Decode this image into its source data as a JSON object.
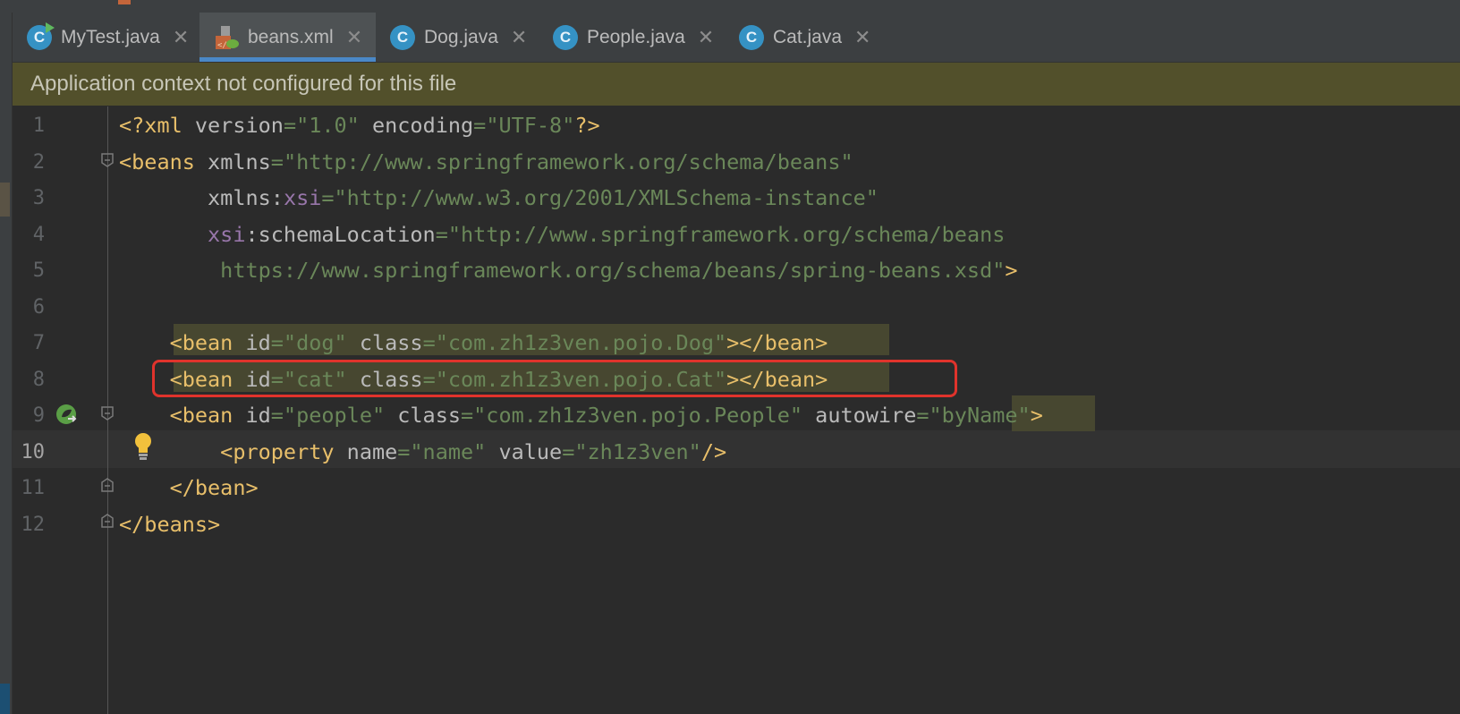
{
  "tabs": [
    {
      "label": "MyTest.java",
      "icon": "java-class-run-icon",
      "active": false
    },
    {
      "label": "beans.xml",
      "icon": "spring-xml-icon",
      "active": true
    },
    {
      "label": "Dog.java",
      "icon": "java-class-icon",
      "active": false
    },
    {
      "label": "People.java",
      "icon": "java-class-icon",
      "active": false
    },
    {
      "label": "Cat.java",
      "icon": "java-class-icon",
      "active": false
    }
  ],
  "tab_close_glyph": "✕",
  "class_icon_letter": "C",
  "banner": {
    "text": "Application context not configured for this file"
  },
  "editor": {
    "line_numbers": [
      "1",
      "2",
      "3",
      "4",
      "5",
      "6",
      "7",
      "8",
      "9",
      "10",
      "11",
      "12"
    ],
    "current_line": "10",
    "lines": [
      [
        {
          "t": "tag",
          "v": "<?xml "
        },
        {
          "t": "attr",
          "v": "version"
        },
        {
          "t": "str",
          "v": "=\"1.0\" "
        },
        {
          "t": "attr",
          "v": "encoding"
        },
        {
          "t": "str",
          "v": "=\"UTF-8\""
        },
        {
          "t": "tag",
          "v": "?>"
        }
      ],
      [
        {
          "t": "tag",
          "v": "<beans "
        },
        {
          "t": "attr",
          "v": "xmlns"
        },
        {
          "t": "str",
          "v": "=\"http://www.springframework.org/schema/beans\""
        }
      ],
      [
        {
          "t": "attr",
          "v": "       xmlns:"
        },
        {
          "t": "ns",
          "v": "xsi"
        },
        {
          "t": "str",
          "v": "=\"http://www.w3.org/2001/XMLSchema-instance\""
        }
      ],
      [
        {
          "t": "ns",
          "v": "       xsi"
        },
        {
          "t": "attr",
          "v": ":schemaLocation"
        },
        {
          "t": "str",
          "v": "=\"http://www.springframework.org/schema/beans"
        }
      ],
      [
        {
          "t": "str",
          "v": "        https://www.springframework.org/schema/beans/spring-beans.xsd\""
        },
        {
          "t": "tag",
          "v": ">"
        }
      ],
      [],
      [
        {
          "t": "tag",
          "v": "    <bean "
        },
        {
          "t": "attr",
          "v": "id"
        },
        {
          "t": "str",
          "v": "=\"dog\" "
        },
        {
          "t": "attr",
          "v": "class"
        },
        {
          "t": "str",
          "v": "=\"com.zh1z3ven.pojo.Dog\""
        },
        {
          "t": "tag",
          "v": "></bean>"
        }
      ],
      [
        {
          "t": "tag",
          "v": "    <bean "
        },
        {
          "t": "attr",
          "v": "id"
        },
        {
          "t": "str",
          "v": "=\"cat\" "
        },
        {
          "t": "attr",
          "v": "class"
        },
        {
          "t": "str",
          "v": "=\"com.zh1z3ven.pojo.Cat\""
        },
        {
          "t": "tag",
          "v": "></bean>"
        }
      ],
      [
        {
          "t": "tag",
          "v": "    <bean "
        },
        {
          "t": "attr",
          "v": "id"
        },
        {
          "t": "str",
          "v": "=\"people\" "
        },
        {
          "t": "attr",
          "v": "class"
        },
        {
          "t": "str",
          "v": "=\"com.zh1z3ven.pojo.People\" "
        },
        {
          "t": "attr",
          "v": "autowire"
        },
        {
          "t": "str",
          "v": "=\"byName\""
        },
        {
          "t": "tag",
          "v": ">"
        }
      ],
      [
        {
          "t": "tag",
          "v": "        <property "
        },
        {
          "t": "attr",
          "v": "name"
        },
        {
          "t": "str",
          "v": "=\"name\" "
        },
        {
          "t": "attr",
          "v": "value"
        },
        {
          "t": "str",
          "v": "=\"zh1z3ven\""
        },
        {
          "t": "tag",
          "v": "/>"
        }
      ],
      [
        {
          "t": "tag",
          "v": "    </bean>"
        }
      ],
      [
        {
          "t": "tag",
          "v": "</beans>"
        }
      ]
    ]
  },
  "colors": {
    "tag": "#e8bf6a",
    "attribute": "#bababa",
    "namespace": "#9876aa",
    "string": "#6a8759",
    "banner_bg": "#52502b",
    "active_tab_underline": "#4a88c7",
    "highlight_box": "#e0332c"
  },
  "gutter_icons": [
    "spring-bean-navigate-icon",
    "intention-bulb-icon"
  ]
}
